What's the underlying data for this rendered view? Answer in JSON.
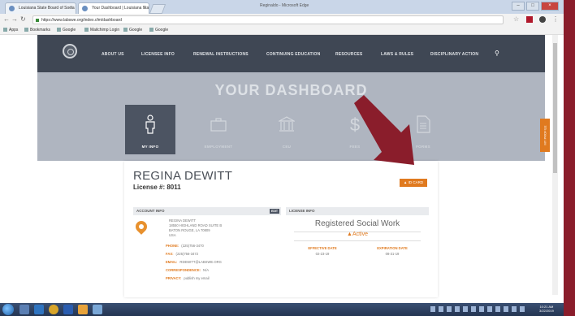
{
  "browser": {
    "tabs": [
      {
        "label": "Louisiana State Board of Socia"
      },
      {
        "label": "Your Dashboard | Louisiana Sta"
      }
    ],
    "profile": "Reginaldo - Microsoft Edge",
    "url": "https://www.labswe.org/index.cfm/dashboard",
    "bookmarks": [
      "Apps",
      "Bookmarks",
      "Google",
      "Mailchimp Login",
      "Google",
      "Google"
    ]
  },
  "site_nav": {
    "items": [
      "ABOUT US",
      "LICENSEE INFO",
      "RENEWAL INSTRUCTIONS",
      "CONTINUING EDUCATION",
      "RESOURCES",
      "LAWS & RULES",
      "DISCIPLINARY ACTION"
    ]
  },
  "hero": {
    "title": "YOUR DASHBOARD",
    "cards": [
      {
        "label": "MY INFO",
        "icon": "person-icon"
      },
      {
        "label": "EMPLOYMENT",
        "icon": "briefcase-icon"
      },
      {
        "label": "CEU",
        "icon": "institution-icon"
      },
      {
        "label": "FEES",
        "icon": "dollar-icon"
      },
      {
        "label": "FORMS",
        "icon": "document-icon"
      }
    ],
    "side_tab": "MY PROFILE"
  },
  "profile": {
    "name": "REGINA DEWITT",
    "license_label": "License #: 8011",
    "id_card_button": "ID CARD",
    "account": {
      "header": "ACCOUNT INFO",
      "edit": "EDIT",
      "address": [
        "REGINA DEWITT",
        "18550 HIGHLAND ROAD SUITE B",
        "BATON ROUGE, LA 70809",
        "USA"
      ],
      "fields": [
        {
          "label": "PHONE:",
          "value": "(225)756-3470"
        },
        {
          "label": "FAX:",
          "value": "(225)756-3472"
        },
        {
          "label": "EMAIL:",
          "value": "RDEWITT@LABSWE.ORG"
        },
        {
          "label": "CORRESPONDENCE:",
          "value": "N/A"
        },
        {
          "label": "PRIVACY:",
          "value": "publish my email"
        }
      ]
    },
    "license": {
      "header": "LICENSE INFO",
      "type": "Registered Social Work",
      "status": "Active",
      "effective_label": "EFFECTIVE DATE",
      "effective_value": "02-23-19",
      "expiration_label": "EXPIRATION DATE",
      "expiration_value": "08-31-19"
    }
  },
  "taskbar": {
    "time": "10:21 AM",
    "date": "3/22/2019"
  },
  "colors": {
    "accent": "#e07a1f",
    "nav": "#3f4754",
    "hero": "#afb5c0",
    "arrow": "#8a1d2b",
    "frame": "#8a1d2b"
  }
}
